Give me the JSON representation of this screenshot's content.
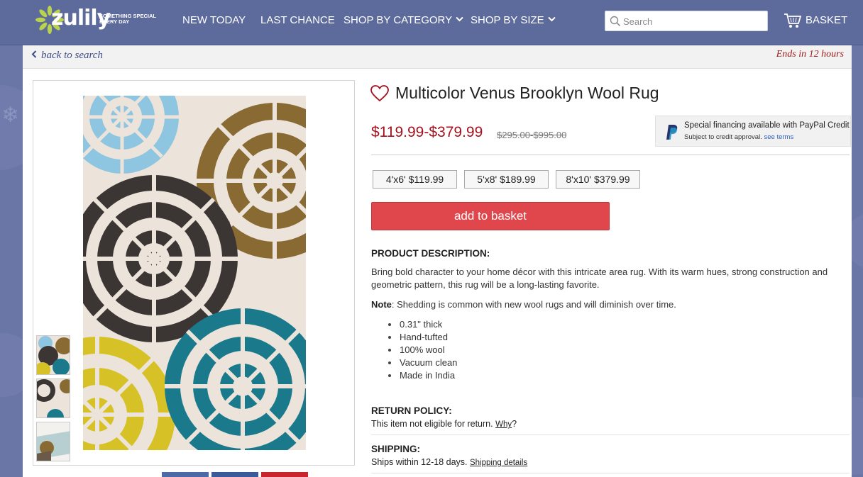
{
  "brand": {
    "name": "zulily",
    "tagline": "SOMETHING SPECIAL EVERY DAY"
  },
  "nav": {
    "items": [
      {
        "label": "NEW TODAY",
        "has_dropdown": false
      },
      {
        "label": "LAST CHANCE",
        "has_dropdown": false
      },
      {
        "label": "SHOP BY CATEGORY",
        "has_dropdown": true
      },
      {
        "label": "SHOP BY SIZE",
        "has_dropdown": true
      }
    ]
  },
  "search": {
    "placeholder": "Search",
    "value": ""
  },
  "basket": {
    "label": "BASKET"
  },
  "subbar": {
    "back_label": "back to search",
    "ends_label": "Ends in 12 hours"
  },
  "product": {
    "title": "Multicolor Venus Brooklyn Wool Rug",
    "price_range": "$119.99-$379.99",
    "original_price_range": "$295.00-$995.00",
    "sizes": [
      {
        "label": "4'x6' $119.99"
      },
      {
        "label": "5'x8' $189.99"
      },
      {
        "label": "8'x10' $379.99"
      }
    ],
    "add_to_basket_label": "add to basket",
    "paypal": {
      "line1": "Special financing available with PayPal Credit",
      "line2": "Subject to credit approval.",
      "link": "see terms"
    }
  },
  "description": {
    "heading": "PRODUCT DESCRIPTION:",
    "text": "Bring bold character to your home décor with this intricate area rug. With its warm hues, strong construction and geometric pattern, this rug will be a long-lasting favorite.",
    "note_label": "Note",
    "note_text": ": Shedding is common with new wool rugs and will diminish over time.",
    "bullets": [
      "0.31\" thick",
      "Hand-tufted",
      "100% wool",
      "Vacuum clean",
      "Made in India"
    ]
  },
  "return_policy": {
    "heading": "RETURN POLICY:",
    "text": "This item not eligible for return.",
    "link": "Why",
    "suffix": "?"
  },
  "shipping": {
    "heading": "SHIPPING:",
    "text": "Ships within 12-18 days.",
    "link": "Shipping details"
  },
  "colors": {
    "header_bg": "#5d6a9c",
    "price_red": "#a3131f",
    "add_button": "#e0474c",
    "rug_blue": "#8ec5e0",
    "rug_brown": "#8a6a33",
    "rug_charcoal": "#3b3633",
    "rug_teal": "#1a7a8c",
    "rug_yellow": "#d6c126"
  },
  "icons": {
    "search": "search-icon",
    "basket": "basket-icon",
    "heart": "heart-icon",
    "back": "chevron-left-icon",
    "dropdown": "chevron-down-icon",
    "paypal": "paypal-icon"
  }
}
